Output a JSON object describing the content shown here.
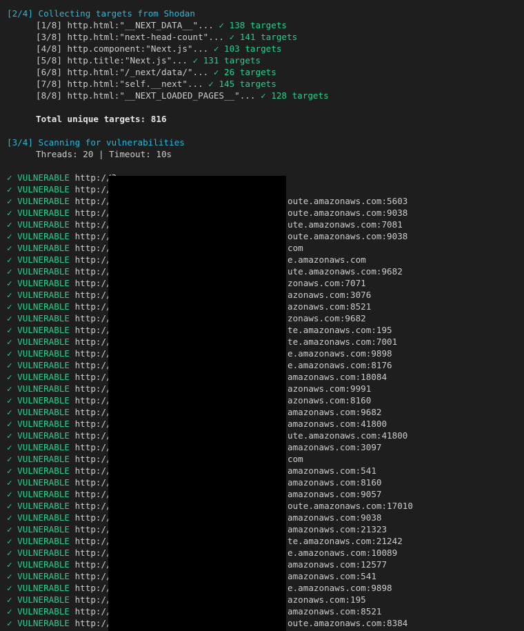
{
  "collect": {
    "header": "[2/4] Collecting targets from Shodan",
    "queries": [
      {
        "step": "[1/8]",
        "query": "http.html:\"__NEXT_DATA__\"...",
        "check": "✓",
        "result": "138 targets"
      },
      {
        "step": "[3/8]",
        "query": "http.html:\"next-head-count\"...",
        "check": "✓",
        "result": "141 targets"
      },
      {
        "step": "[4/8]",
        "query": "http.component:\"Next.js\"...",
        "check": "✓",
        "result": "103 targets"
      },
      {
        "step": "[5/8]",
        "query": "http.title:\"Next.js\"...",
        "check": "✓",
        "result": "131 targets"
      },
      {
        "step": "[6/8]",
        "query": "http.html:\"/_next/data/\"...",
        "check": "✓",
        "result": "26 targets"
      },
      {
        "step": "[7/8]",
        "query": "http.html:\"self.__next\"...",
        "check": "✓",
        "result": "145 targets"
      },
      {
        "step": "[8/8]",
        "query": "http.html:\"__NEXT_LOADED_PAGES__\"...",
        "check": "✓",
        "result": "128 targets"
      }
    ],
    "total": "Total unique targets: 816"
  },
  "scan": {
    "header": "[3/4] Scanning for vulnerabilities",
    "config": "Threads: 20 | Timeout: 10s"
  },
  "results": {
    "label": "✓ VULNERABLE",
    "rows": [
      {
        "prefix": "http://3",
        "suffix": ""
      },
      {
        "prefix": "http://5",
        "suffix": ""
      },
      {
        "prefix": "http://e",
        "suffix": "oute.amazonaws.com:5603"
      },
      {
        "prefix": "http://e",
        "suffix": "oute.amazonaws.com:9038"
      },
      {
        "prefix": "http://e",
        "suffix": "ute.amazonaws.com:7081"
      },
      {
        "prefix": "http://e",
        "suffix": "oute.amazonaws.com:9038"
      },
      {
        "prefix": "http://e",
        "suffix": "com"
      },
      {
        "prefix": "http://e",
        "suffix": "e.amazonaws.com"
      },
      {
        "prefix": "http://e",
        "suffix": "ute.amazonaws.com:9682"
      },
      {
        "prefix": "http://e",
        "suffix": "zonaws.com:7071"
      },
      {
        "prefix": "http://e",
        "suffix": "azonaws.com:3076"
      },
      {
        "prefix": "http://e",
        "suffix": "azonaws.com:8521"
      },
      {
        "prefix": "http://e",
        "suffix": "zonaws.com:9682"
      },
      {
        "prefix": "http://e",
        "suffix": "te.amazonaws.com:195"
      },
      {
        "prefix": "http://e",
        "suffix": "te.amazonaws.com:7001"
      },
      {
        "prefix": "http://e",
        "suffix": "e.amazonaws.com:9898"
      },
      {
        "prefix": "http://e",
        "suffix": "e.amazonaws.com:8176"
      },
      {
        "prefix": "http://e",
        "suffix": "amazonaws.com:18084"
      },
      {
        "prefix": "http://e",
        "suffix": "azonaws.com:9991"
      },
      {
        "prefix": "http://e",
        "suffix": "azonaws.com:8160"
      },
      {
        "prefix": "http://e",
        "suffix": "amazonaws.com:9682"
      },
      {
        "prefix": "http://e",
        "suffix": "amazonaws.com:41800"
      },
      {
        "prefix": "http://e",
        "suffix": "ute.amazonaws.com:41800"
      },
      {
        "prefix": "http://e",
        "suffix": "amazonaws.com:3097"
      },
      {
        "prefix": "http://e",
        "suffix": "com"
      },
      {
        "prefix": "http://e",
        "suffix": "amazonaws.com:541"
      },
      {
        "prefix": "http://e",
        "suffix": "amazonaws.com:8160"
      },
      {
        "prefix": "http://e",
        "suffix": "amazonaws.com:9057"
      },
      {
        "prefix": "http://e",
        "suffix": "oute.amazonaws.com:17010"
      },
      {
        "prefix": "http://e",
        "suffix": "amazonaws.com:9038"
      },
      {
        "prefix": "http://e",
        "suffix": "amazonaws.com:21323"
      },
      {
        "prefix": "http://e",
        "suffix": "te.amazonaws.com:21242"
      },
      {
        "prefix": "http://e",
        "suffix": "e.amazonaws.com:10089"
      },
      {
        "prefix": "http://e",
        "suffix": "amazonaws.com:12577"
      },
      {
        "prefix": "http://e",
        "suffix": "amazonaws.com:541"
      },
      {
        "prefix": "http://e",
        "suffix": "e.amazonaws.com:9898"
      },
      {
        "prefix": "http://e",
        "suffix": "azonaws.com:195"
      },
      {
        "prefix": "http://e",
        "suffix": "amazonaws.com:8521"
      },
      {
        "prefix": "http://e",
        "suffix": "oute.amazonaws.com:8384"
      }
    ]
  },
  "colors": {
    "background": "#1e1e1e",
    "stage": "#29b8db",
    "success": "#23d18b",
    "text": "#cccccc",
    "redaction": "#000000"
  }
}
